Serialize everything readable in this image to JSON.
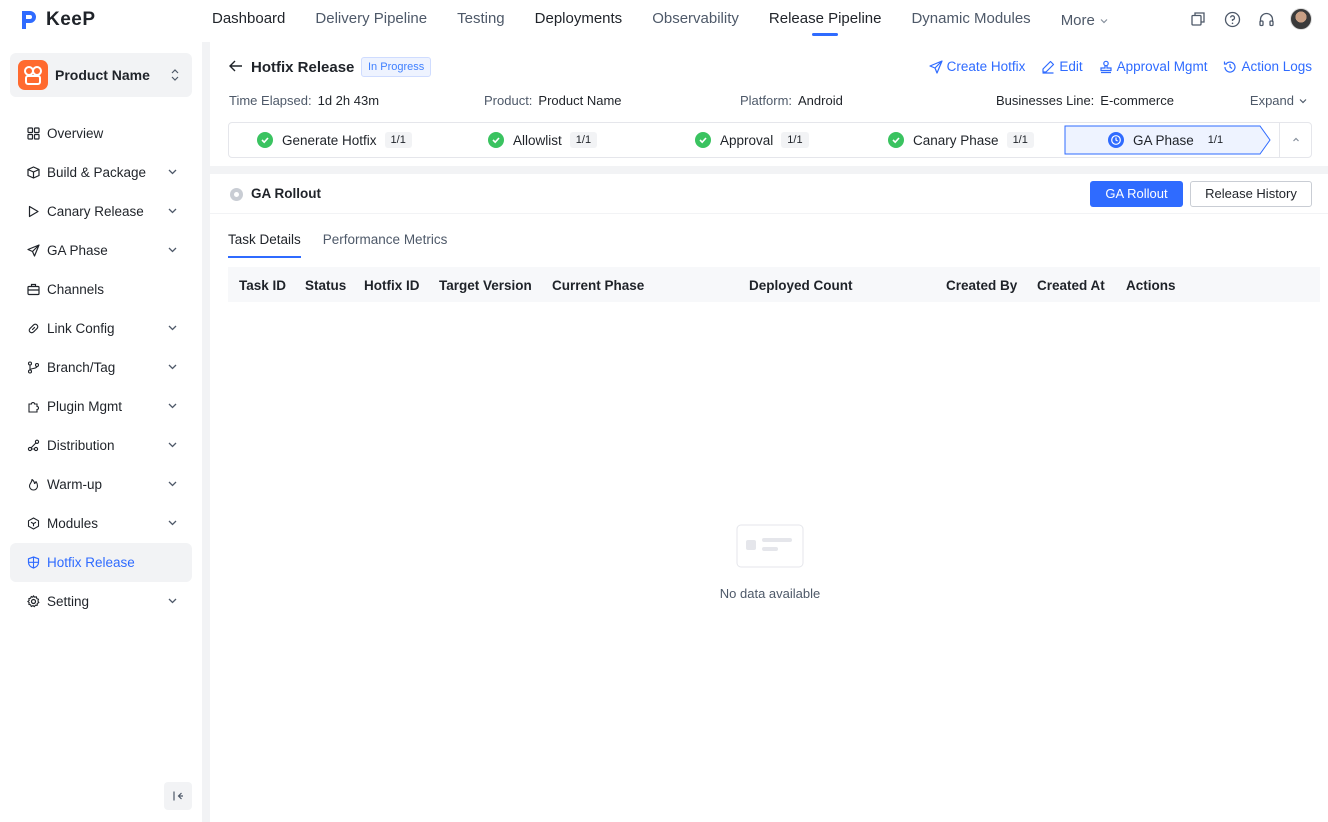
{
  "brand": {
    "name": "KeeP"
  },
  "nav": {
    "items": [
      {
        "label": "Dashboard"
      },
      {
        "label": "Delivery Pipeline"
      },
      {
        "label": "Testing"
      },
      {
        "label": "Deployments"
      },
      {
        "label": "Observability"
      },
      {
        "label": "Release Pipeline"
      },
      {
        "label": "Dynamic Modules"
      },
      {
        "label": "More"
      }
    ],
    "active": "Release Pipeline"
  },
  "sidebar": {
    "product": "Product Name",
    "items": [
      {
        "label": "Overview",
        "icon": "grid-icon"
      },
      {
        "label": "Build & Package",
        "icon": "package-icon"
      },
      {
        "label": "Canary Release",
        "icon": "play-icon"
      },
      {
        "label": "GA Phase",
        "icon": "send-icon"
      },
      {
        "label": "Channels",
        "icon": "briefcase-icon"
      },
      {
        "label": "Link Config",
        "icon": "link-icon"
      },
      {
        "label": "Branch/Tag",
        "icon": "branch-icon"
      },
      {
        "label": "Plugin Mgmt",
        "icon": "puzzle-icon"
      },
      {
        "label": "Distribution",
        "icon": "share-icon"
      },
      {
        "label": "Warm-up",
        "icon": "flame-icon"
      },
      {
        "label": "Modules",
        "icon": "cube-icon"
      },
      {
        "label": "Hotfix Release",
        "icon": "shield-icon"
      },
      {
        "label": "Setting",
        "icon": "gear-icon"
      }
    ],
    "active": "Hotfix Release"
  },
  "header": {
    "title": "Hotfix Release",
    "status": "In Progress",
    "actions": {
      "create": "Create Hotfix",
      "edit": "Edit",
      "approval": "Approval Mgmt",
      "logs": "Action Logs"
    },
    "meta": {
      "elapsed_label": "Time Elapsed:",
      "elapsed_value": "1d 2h 43m",
      "product_label": "Product:",
      "product_value": "Product Name",
      "platform_label": "Platform:",
      "platform_value": "Android",
      "business_label": "Businesses Line:",
      "business_value": "E-commerce"
    },
    "expand": "Expand"
  },
  "steps": [
    {
      "label": "Generate Hotfix",
      "count": "1/1",
      "state": "done"
    },
    {
      "label": "Allowlist",
      "count": "1/1",
      "state": "done"
    },
    {
      "label": "Approval",
      "count": "1/1",
      "state": "done"
    },
    {
      "label": "Canary Phase",
      "count": "1/1",
      "state": "done"
    },
    {
      "label": "GA Phase",
      "count": "1/1",
      "state": "current"
    }
  ],
  "section": {
    "title": "GA Rollout",
    "primary_button": "GA Rollout",
    "secondary_button": "Release History"
  },
  "tabs": [
    {
      "label": "Task Details"
    },
    {
      "label": "Performance Metrics"
    }
  ],
  "table": {
    "columns": [
      "Task ID",
      "Status",
      "Hotfix ID",
      "Target Version",
      "Current Phase",
      "Deployed Count",
      "Created By",
      "Created At",
      "Actions"
    ],
    "rows": [],
    "empty": "No data available"
  },
  "colors": {
    "accent": "#2f6bff",
    "success": "#3ac360",
    "brand_orange": "#ff6a2f"
  }
}
